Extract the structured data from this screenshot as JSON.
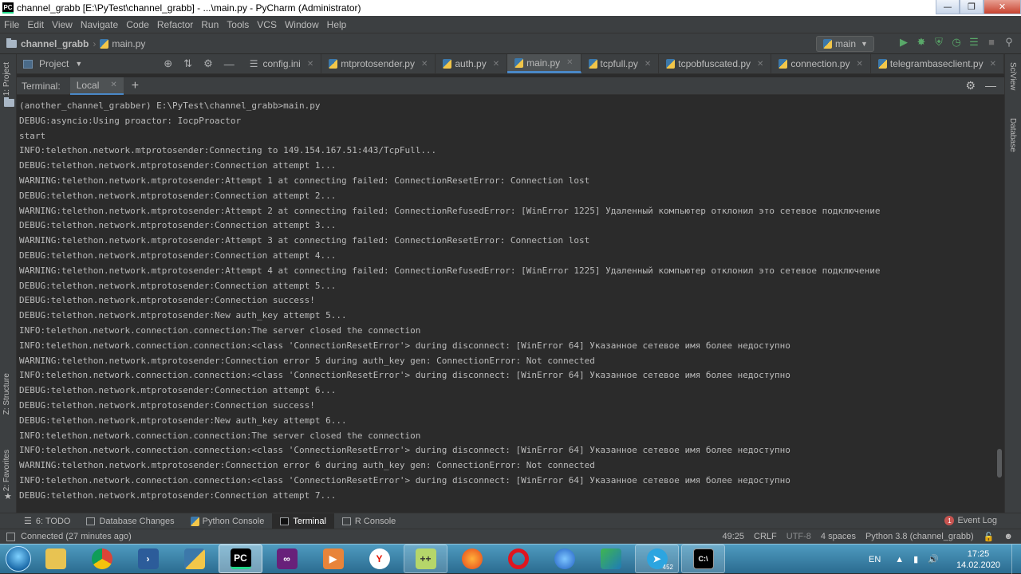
{
  "window": {
    "title": "channel_grabb [E:\\PyTest\\channel_grabb] - ...\\main.py - PyCharm (Administrator)",
    "app_icon_text": "PC"
  },
  "menu": [
    "File",
    "Edit",
    "View",
    "Navigate",
    "Code",
    "Refactor",
    "Run",
    "Tools",
    "VCS",
    "Window",
    "Help"
  ],
  "breadcrumb": {
    "project": "channel_grabb",
    "file": "main.py"
  },
  "run_config": "main",
  "project_toggle": "Project",
  "editor_tabs": [
    {
      "label": "config.ini",
      "active": false
    },
    {
      "label": "mtprotosender.py",
      "active": false
    },
    {
      "label": "auth.py",
      "active": false
    },
    {
      "label": "main.py",
      "active": true
    },
    {
      "label": "tcpfull.py",
      "active": false
    },
    {
      "label": "tcpobfuscated.py",
      "active": false
    },
    {
      "label": "connection.py",
      "active": false
    },
    {
      "label": "telegrambaseclient.py",
      "active": false
    }
  ],
  "terminal_header": {
    "label": "Terminal:",
    "tab": "Local"
  },
  "terminal_lines": [
    "(another_channel_grabber) E:\\PyTest\\channel_grabb>main.py",
    "DEBUG:asyncio:Using proactor: IocpProactor",
    "start",
    "INFO:telethon.network.mtprotosender:Connecting to 149.154.167.51:443/TcpFull...",
    "DEBUG:telethon.network.mtprotosender:Connection attempt 1...",
    "WARNING:telethon.network.mtprotosender:Attempt 1 at connecting failed: ConnectionResetError: Connection lost",
    "DEBUG:telethon.network.mtprotosender:Connection attempt 2...",
    "WARNING:telethon.network.mtprotosender:Attempt 2 at connecting failed: ConnectionRefusedError: [WinError 1225] Удаленный компьютер отклонил это сетевое подключение",
    "DEBUG:telethon.network.mtprotosender:Connection attempt 3...",
    "WARNING:telethon.network.mtprotosender:Attempt 3 at connecting failed: ConnectionResetError: Connection lost",
    "DEBUG:telethon.network.mtprotosender:Connection attempt 4...",
    "WARNING:telethon.network.mtprotosender:Attempt 4 at connecting failed: ConnectionRefusedError: [WinError 1225] Удаленный компьютер отклонил это сетевое подключение",
    "DEBUG:telethon.network.mtprotosender:Connection attempt 5...",
    "DEBUG:telethon.network.mtprotosender:Connection success!",
    "DEBUG:telethon.network.mtprotosender:New auth_key attempt 5...",
    "INFO:telethon.network.connection.connection:The server closed the connection",
    "INFO:telethon.network.connection.connection:<class 'ConnectionResetError'> during disconnect: [WinError 64] Указанное сетевое имя более недоступно",
    "WARNING:telethon.network.mtprotosender:Connection error 5 during auth_key gen: ConnectionError: Not connected",
    "INFO:telethon.network.connection.connection:<class 'ConnectionResetError'> during disconnect: [WinError 64] Указанное сетевое имя более недоступно",
    "DEBUG:telethon.network.mtprotosender:Connection attempt 6...",
    "DEBUG:telethon.network.mtprotosender:Connection success!",
    "DEBUG:telethon.network.mtprotosender:New auth_key attempt 6...",
    "INFO:telethon.network.connection.connection:The server closed the connection",
    "INFO:telethon.network.connection.connection:<class 'ConnectionResetError'> during disconnect: [WinError 64] Указанное сетевое имя более недоступно",
    "WARNING:telethon.network.mtprotosender:Connection error 6 during auth_key gen: ConnectionError: Not connected",
    "INFO:telethon.network.connection.connection:<class 'ConnectionResetError'> during disconnect: [WinError 64] Указанное сетевое имя более недоступно",
    "DEBUG:telethon.network.mtprotosender:Connection attempt 7..."
  ],
  "left_stripe": {
    "project": "1: Project",
    "structure": "Z: Structure",
    "favorites": "2: Favorites"
  },
  "right_stripe": {
    "sciview": "SciView",
    "database": "Database"
  },
  "bottom_tabs": [
    {
      "label": "6: TODO",
      "active": false
    },
    {
      "label": "Database Changes",
      "active": false
    },
    {
      "label": "Python Console",
      "active": false
    },
    {
      "label": "Terminal",
      "active": true
    },
    {
      "label": "R Console",
      "active": false
    }
  ],
  "event_log": {
    "label": "Event Log",
    "count": "1"
  },
  "status": {
    "message": "Connected (27 minutes ago)",
    "position": "49:25",
    "line_sep": "CRLF",
    "encoding": "UTF-8",
    "indent": "4 spaces",
    "interpreter": "Python 3.8 (channel_grabb)"
  },
  "taskbar": {
    "lang": "EN",
    "time": "17:25",
    "date": "14.02.2020",
    "telegram_badge": "452"
  },
  "colors": {
    "ide_bg": "#2b2b2b",
    "panel_bg": "#3c3f41",
    "text": "#bbbbbb",
    "accent": "#4a88c7"
  }
}
